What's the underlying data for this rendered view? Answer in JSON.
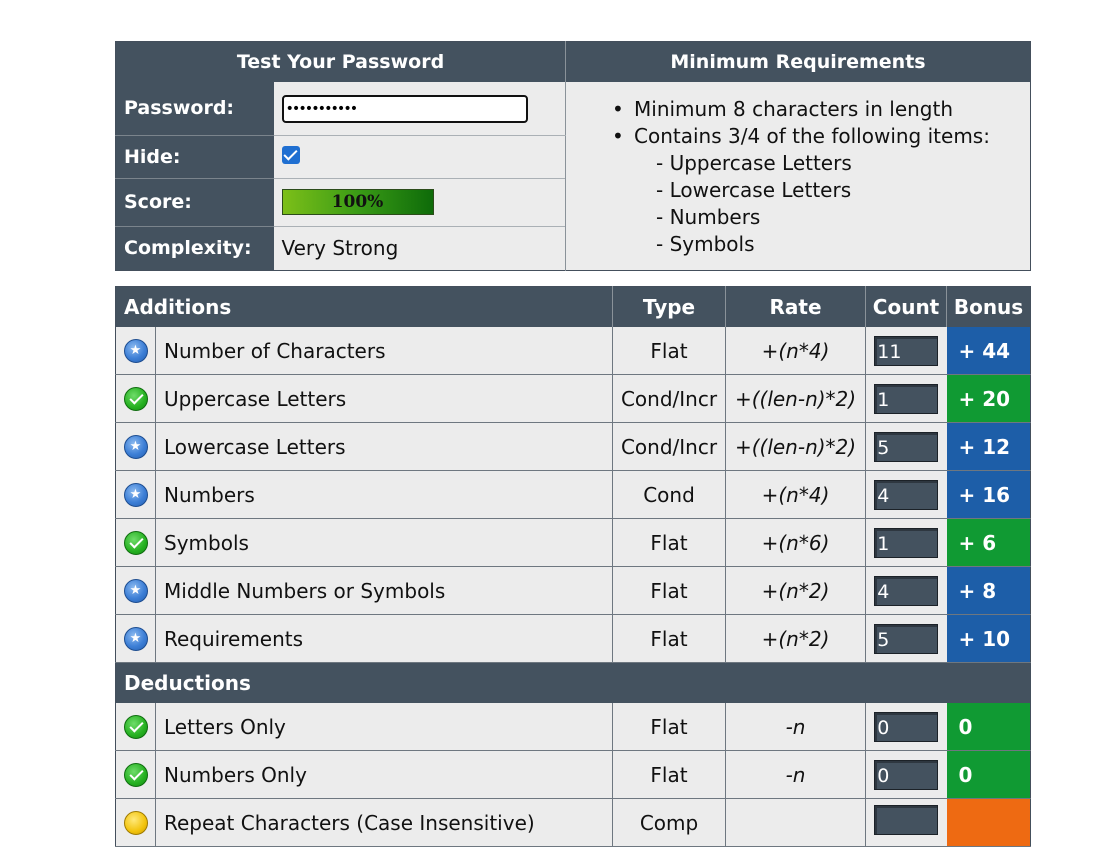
{
  "test_panel": {
    "title": "Test Your Password",
    "password_label": "Password:",
    "password_value": "•••••••••••",
    "hide_label": "Hide:",
    "hide_checked": true,
    "score_label": "Score:",
    "score_text": "100%",
    "score_fraction": 1.0,
    "complexity_label": "Complexity:",
    "complexity_value": "Very Strong"
  },
  "requirements_panel": {
    "title": "Minimum Requirements",
    "items": [
      "Minimum 8 characters in length",
      "Contains 3/4 of the following items:"
    ],
    "sub_items": [
      "- Uppercase Letters",
      "- Lowercase Letters",
      "- Numbers",
      "- Symbols"
    ]
  },
  "scoring": {
    "headers": {
      "additions": "Additions",
      "type": "Type",
      "rate": "Rate",
      "count": "Count",
      "bonus": "Bonus"
    },
    "additions": [
      {
        "icon": "plus-star-icon",
        "name": "Number of Characters",
        "type": "Flat",
        "rate": "+(n*4)",
        "count": "11",
        "bonus": "+ 44",
        "bonus_color": "blue"
      },
      {
        "icon": "check-icon",
        "name": "Uppercase Letters",
        "type": "Cond/Incr",
        "rate": "+((len-n)*2)",
        "count": "1",
        "bonus": "+ 20",
        "bonus_color": "green"
      },
      {
        "icon": "plus-star-icon",
        "name": "Lowercase Letters",
        "type": "Cond/Incr",
        "rate": "+((len-n)*2)",
        "count": "5",
        "bonus": "+ 12",
        "bonus_color": "blue"
      },
      {
        "icon": "plus-star-icon",
        "name": "Numbers",
        "type": "Cond",
        "rate": "+(n*4)",
        "count": "4",
        "bonus": "+ 16",
        "bonus_color": "blue"
      },
      {
        "icon": "check-icon",
        "name": "Symbols",
        "type": "Flat",
        "rate": "+(n*6)",
        "count": "1",
        "bonus": "+ 6",
        "bonus_color": "green"
      },
      {
        "icon": "plus-star-icon",
        "name": "Middle Numbers or Symbols",
        "type": "Flat",
        "rate": "+(n*2)",
        "count": "4",
        "bonus": "+ 8",
        "bonus_color": "blue"
      },
      {
        "icon": "plus-star-icon",
        "name": "Requirements",
        "type": "Flat",
        "rate": "+(n*2)",
        "count": "5",
        "bonus": "+ 10",
        "bonus_color": "blue"
      }
    ],
    "deductions_title": "Deductions",
    "deductions": [
      {
        "icon": "check-icon",
        "name": "Letters Only",
        "type": "Flat",
        "rate": "-n",
        "count": "0",
        "bonus": "0",
        "bonus_color": "green"
      },
      {
        "icon": "check-icon",
        "name": "Numbers Only",
        "type": "Flat",
        "rate": "-n",
        "count": "0",
        "bonus": "0",
        "bonus_color": "green"
      },
      {
        "icon": "warning-icon",
        "name": "Repeat Characters (Case Insensitive)",
        "type": "Comp",
        "rate": "",
        "count": "",
        "bonus": "",
        "bonus_color": "orange"
      }
    ]
  },
  "colors": {
    "header_bg": "#44525f",
    "cell_bg": "#ececec",
    "bonus_blue": "#1d5ea8",
    "bonus_green": "#109a33",
    "bonus_orange": "#ee6a12"
  }
}
